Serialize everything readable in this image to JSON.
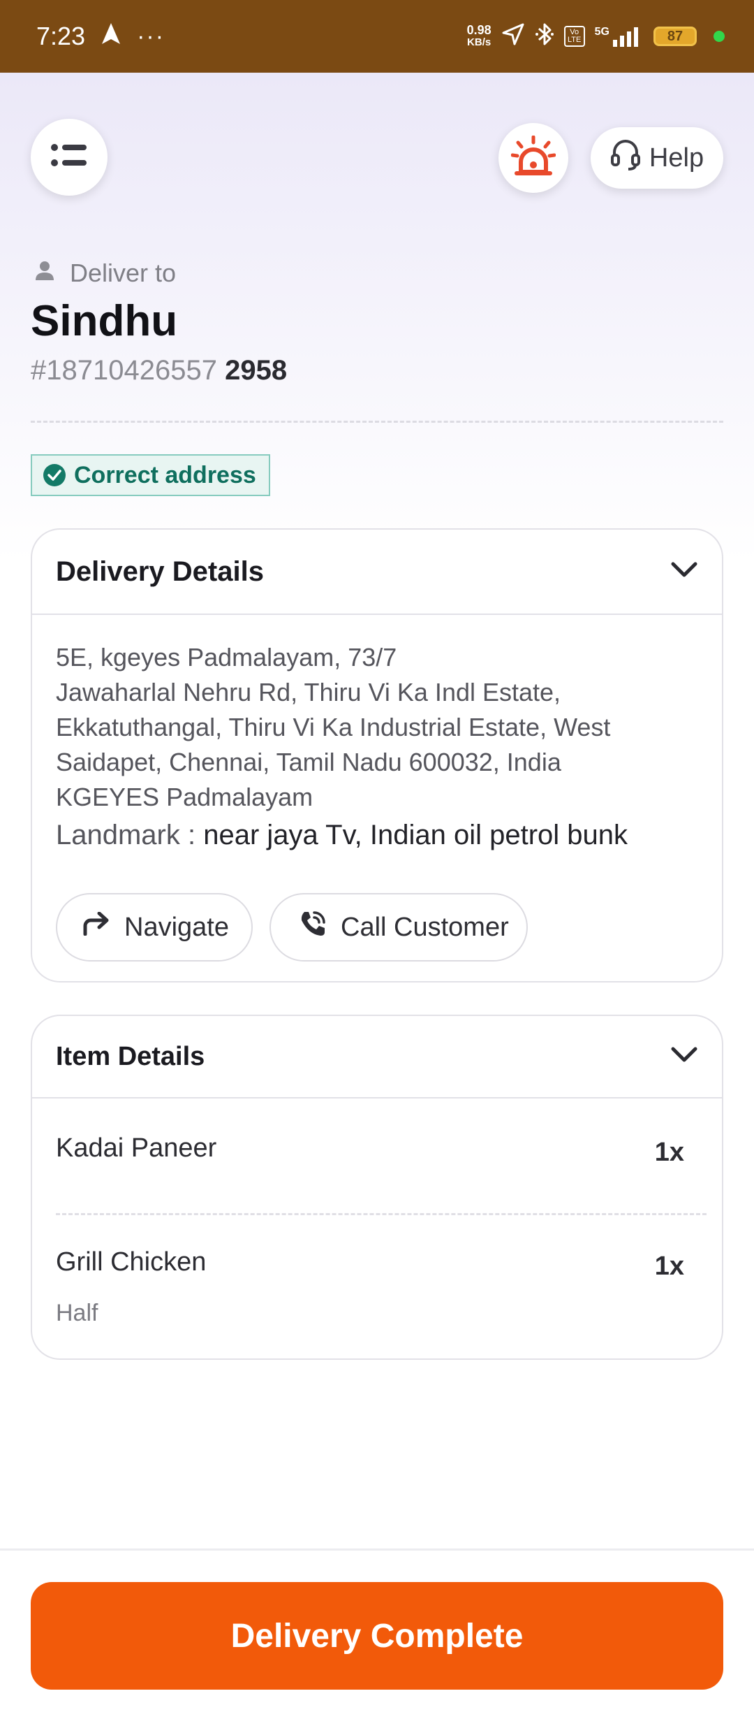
{
  "status_bar": {
    "time": "7:23",
    "more": "···",
    "net_speed_value": "0.98",
    "net_speed_unit": "KB/s",
    "volte": "Vo LTE",
    "network": "5G",
    "battery": "87"
  },
  "header": {
    "help_label": "Help"
  },
  "customer": {
    "deliver_to_label": "Deliver to",
    "name": "Sindhu",
    "order_id": "#18710426557",
    "order_suffix": "2958"
  },
  "address_badge": {
    "label": "Correct address"
  },
  "delivery_details": {
    "title": "Delivery Details",
    "address_lines": [
      "5E, kgeyes Padmalayam, 73/7",
      "Jawaharlal Nehru Rd, Thiru Vi Ka Indl Estate,",
      "Ekkatuthangal, Thiru Vi Ka Industrial Estate, West",
      "Saidapet, Chennai, Tamil Nadu 600032, India",
      "KGEYES Padmalayam"
    ],
    "landmark_label": "Landmark : ",
    "landmark_value": "near jaya Tv, Indian oil petrol bunk",
    "navigate_label": "Navigate",
    "call_label": "Call Customer"
  },
  "item_details": {
    "title": "Item Details",
    "items": [
      {
        "name": "Kadai Paneer",
        "qty": "1x",
        "variant": ""
      },
      {
        "name": "Grill Chicken",
        "qty": "1x",
        "variant": "Half"
      }
    ]
  },
  "footer": {
    "complete_label": "Delivery Complete"
  },
  "colors": {
    "status_bar": "#7b4a13",
    "accent_orange": "#f25a0a",
    "success_green": "#137a67",
    "alarm_red": "#e8492b"
  }
}
